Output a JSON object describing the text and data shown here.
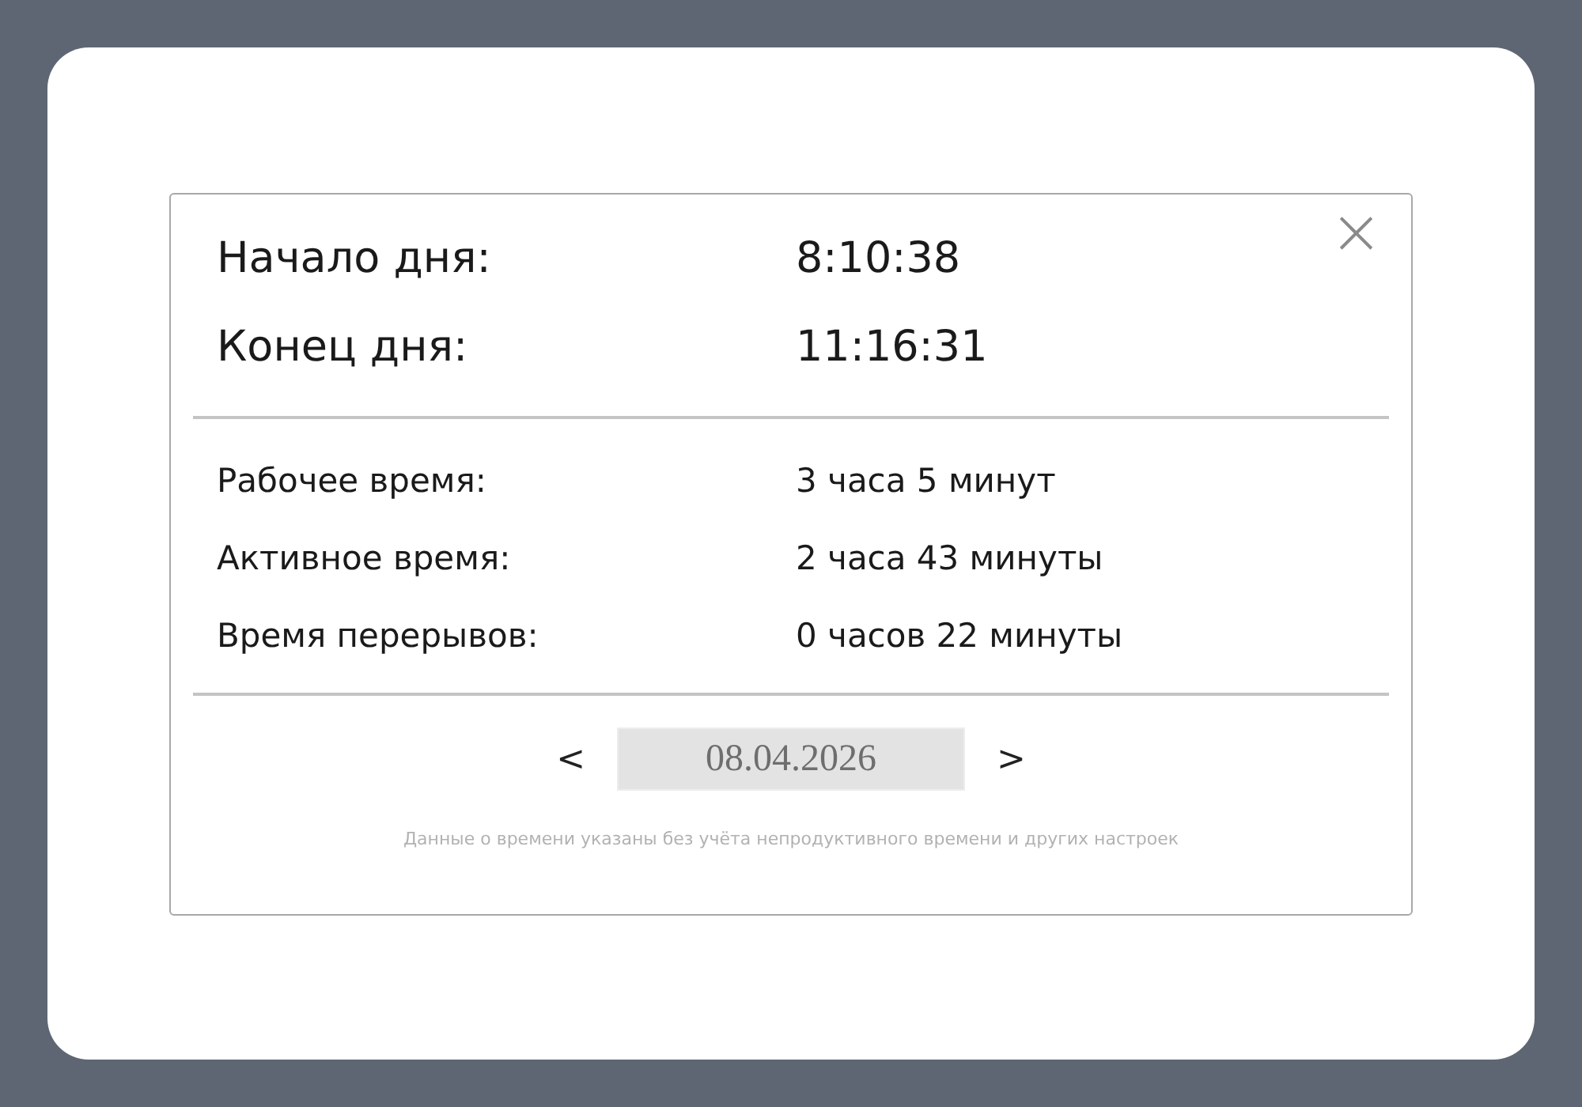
{
  "close_button": {
    "label": "×"
  },
  "day_bounds": [
    {
      "label": "Начало дня:",
      "value": "8:10:38"
    },
    {
      "label": "Конец дня:",
      "value": "11:16:31"
    }
  ],
  "time_stats": [
    {
      "label": "Рабочее время:",
      "value": "3 часа 5 минут"
    },
    {
      "label": "Активное время:",
      "value": "2 часа 43 минуты"
    },
    {
      "label": "Время перерывов:",
      "value": "0 часов 22 минуты"
    }
  ],
  "date_nav": {
    "prev": "<",
    "date": "08.04.2026",
    "next": ">"
  },
  "footnote": "Данные о времени указаны без учёта непродуктивного времени и других настроек"
}
